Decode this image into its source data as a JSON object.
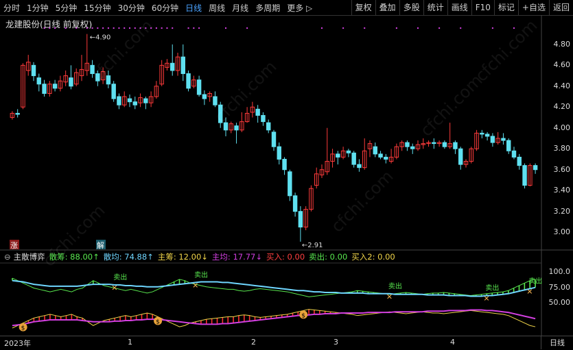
{
  "toolbar": {
    "left_items": [
      "分时",
      "1分钟",
      "5分钟",
      "15分钟",
      "30分钟",
      "60分钟",
      "日线",
      "周线",
      "月线",
      "多周期",
      "更多 ▷"
    ],
    "active_index": 6,
    "right_items": [
      "复权",
      "叠加",
      "多股",
      "统计",
      "画线",
      "F10",
      "标记",
      "+自选",
      "返回"
    ]
  },
  "title": "龙建股份(日线 前复权)",
  "price_axis": [
    "4.80",
    "4.60",
    "4.40",
    "4.20",
    "4.00",
    "3.80",
    "3.60",
    "3.40",
    "3.20",
    "3.00"
  ],
  "annotations": {
    "high": "4.90",
    "low": "2.91",
    "zhang": "涨",
    "jie": "解"
  },
  "indicator": {
    "name": "主散博弈",
    "items": [
      {
        "label": "散筹: 88.00↑",
        "color": "#59e84f"
      },
      {
        "label": "散均: 74.88↑",
        "color": "#6fd6ff"
      },
      {
        "label": "主筹: 12.00↓",
        "color": "#f2d64a"
      },
      {
        "label": "主均: 17.77↓",
        "color": "#d23fe0"
      },
      {
        "label": "买入: 0.00",
        "color": "#ff4040"
      },
      {
        "label": "卖出: 0.00",
        "color": "#59e84f"
      },
      {
        "label": "买入2: 0.00",
        "color": "#f2d64a"
      }
    ],
    "axis": [
      "100.0",
      "75.00",
      "50.00"
    ],
    "sell_label": "卖出"
  },
  "x_axis": [
    "2023年",
    "1",
    "2",
    "3",
    "4"
  ],
  "period": "日线",
  "watermark": "cfchi.com",
  "chart_data": {
    "type": "candlestick",
    "ylim": [
      2.85,
      4.95
    ],
    "candles": [
      [
        4.1,
        4.14,
        4.08,
        4.16
      ],
      [
        4.14,
        4.13,
        4.1,
        4.18
      ],
      [
        4.2,
        4.6,
        4.18,
        4.62
      ],
      [
        4.55,
        4.63,
        4.5,
        4.7
      ],
      [
        4.6,
        4.5,
        4.45,
        4.63
      ],
      [
        4.48,
        4.42,
        4.35,
        4.52
      ],
      [
        4.42,
        4.33,
        4.3,
        4.46
      ],
      [
        4.33,
        4.42,
        4.3,
        4.45
      ],
      [
        4.42,
        4.38,
        4.35,
        4.46
      ],
      [
        4.38,
        4.45,
        4.35,
        4.5
      ],
      [
        4.44,
        4.5,
        4.4,
        4.55
      ],
      [
        4.48,
        4.4,
        4.37,
        4.6
      ],
      [
        4.42,
        4.53,
        4.4,
        4.57
      ],
      [
        4.5,
        4.56,
        4.45,
        4.7
      ],
      [
        4.55,
        4.62,
        4.5,
        4.9
      ],
      [
        4.6,
        4.52,
        4.48,
        4.65
      ],
      [
        4.52,
        4.45,
        4.4,
        4.55
      ],
      [
        4.46,
        4.54,
        4.42,
        4.58
      ],
      [
        4.5,
        4.42,
        4.38,
        4.55
      ],
      [
        4.42,
        4.28,
        4.25,
        4.45
      ],
      [
        4.3,
        4.22,
        4.18,
        4.33
      ],
      [
        4.22,
        4.3,
        4.2,
        4.35
      ],
      [
        4.28,
        4.25,
        4.2,
        4.32
      ],
      [
        4.25,
        4.22,
        4.18,
        4.3
      ],
      [
        4.24,
        4.29,
        4.2,
        4.33
      ],
      [
        4.28,
        4.24,
        4.18,
        4.3
      ],
      [
        4.24,
        4.3,
        4.2,
        4.35
      ],
      [
        4.3,
        4.4,
        4.28,
        4.45
      ],
      [
        4.42,
        4.6,
        4.4,
        4.65
      ],
      [
        4.58,
        4.62,
        4.55,
        4.66
      ],
      [
        4.62,
        4.55,
        4.5,
        4.8
      ],
      [
        4.55,
        4.68,
        4.5,
        4.72
      ],
      [
        4.68,
        4.52,
        4.45,
        4.8
      ],
      [
        4.52,
        4.38,
        4.35,
        4.55
      ],
      [
        4.4,
        4.46,
        4.38,
        4.5
      ],
      [
        4.46,
        4.32,
        4.3,
        4.5
      ],
      [
        4.32,
        4.28,
        4.22,
        4.36
      ],
      [
        4.3,
        4.33,
        4.25,
        4.35
      ],
      [
        4.3,
        4.22,
        4.2,
        4.35
      ],
      [
        4.22,
        4.05,
        4.0,
        4.25
      ],
      [
        4.05,
        3.98,
        3.92,
        4.1
      ],
      [
        3.98,
        4.04,
        3.95,
        4.06
      ],
      [
        4.02,
        3.98,
        3.85,
        4.05
      ],
      [
        3.98,
        4.06,
        3.96,
        4.15
      ],
      [
        4.06,
        4.14,
        4.05,
        4.2
      ],
      [
        4.15,
        4.2,
        4.1,
        4.25
      ],
      [
        4.18,
        4.12,
        4.05,
        4.22
      ],
      [
        4.12,
        4.06,
        4.02,
        4.15
      ],
      [
        4.05,
        3.98,
        3.95,
        4.08
      ],
      [
        3.96,
        3.82,
        3.78,
        3.98
      ],
      [
        3.82,
        3.7,
        3.65,
        3.86
      ],
      [
        3.7,
        3.6,
        3.55,
        3.72
      ],
      [
        3.58,
        3.35,
        3.3,
        3.6
      ],
      [
        3.35,
        3.2,
        3.15,
        3.38
      ],
      [
        3.2,
        3.05,
        2.91,
        3.25
      ],
      [
        3.05,
        3.22,
        3.02,
        3.25
      ],
      [
        3.22,
        3.42,
        3.2,
        3.45
      ],
      [
        3.45,
        3.56,
        3.42,
        3.62
      ],
      [
        3.55,
        3.6,
        3.52,
        3.65
      ],
      [
        3.58,
        3.68,
        3.55,
        4.0
      ],
      [
        3.68,
        3.75,
        3.62,
        3.8
      ],
      [
        3.75,
        3.72,
        3.65,
        3.78
      ],
      [
        3.72,
        3.78,
        3.7,
        3.82
      ],
      [
        3.78,
        3.76,
        3.72,
        3.8
      ],
      [
        3.76,
        3.65,
        3.62,
        3.78
      ],
      [
        3.65,
        3.62,
        3.58,
        3.7
      ],
      [
        3.62,
        3.78,
        3.6,
        3.9
      ],
      [
        3.8,
        3.85,
        3.72,
        3.88
      ],
      [
        3.82,
        3.75,
        3.72,
        3.86
      ],
      [
        3.75,
        3.72,
        3.7,
        3.78
      ],
      [
        3.72,
        3.7,
        3.66,
        3.75
      ],
      [
        3.68,
        3.72,
        3.66,
        3.8
      ],
      [
        3.72,
        3.82,
        3.7,
        3.85
      ],
      [
        3.82,
        3.86,
        3.78,
        3.88
      ],
      [
        3.86,
        3.82,
        3.78,
        3.88
      ],
      [
        3.82,
        3.8,
        3.75,
        3.85
      ],
      [
        3.8,
        3.84,
        3.78,
        3.88
      ],
      [
        3.84,
        3.85,
        3.8,
        3.9
      ],
      [
        3.85,
        3.86,
        3.82,
        3.88
      ],
      [
        3.86,
        3.85,
        3.8,
        3.9
      ],
      [
        3.85,
        3.86,
        3.82,
        3.88
      ],
      [
        3.86,
        3.82,
        3.8,
        3.88
      ],
      [
        3.82,
        3.85,
        3.8,
        4.05
      ],
      [
        3.86,
        3.8,
        3.75,
        3.88
      ],
      [
        3.8,
        3.65,
        3.6,
        3.82
      ],
      [
        3.65,
        3.68,
        3.62,
        3.7
      ],
      [
        3.68,
        3.8,
        3.66,
        3.82
      ],
      [
        3.8,
        3.95,
        3.78,
        3.98
      ],
      [
        3.95,
        3.94,
        3.9,
        3.98
      ],
      [
        3.94,
        3.92,
        3.88,
        3.96
      ],
      [
        3.92,
        3.86,
        3.82,
        3.95
      ],
      [
        3.86,
        3.9,
        3.84,
        3.96
      ],
      [
        3.9,
        3.88,
        3.84,
        3.95
      ],
      [
        3.88,
        3.78,
        3.75,
        3.9
      ],
      [
        3.78,
        3.72,
        3.7,
        3.82
      ],
      [
        3.72,
        3.64,
        3.6,
        3.75
      ],
      [
        3.64,
        3.45,
        3.42,
        3.66
      ],
      [
        3.45,
        3.64,
        3.44,
        3.66
      ],
      [
        3.64,
        3.6,
        3.56,
        3.66
      ]
    ],
    "sanchou": [
      90,
      86,
      82,
      78,
      74,
      72,
      70,
      68,
      70,
      72,
      70,
      68,
      72,
      74,
      80,
      86,
      82,
      78,
      76,
      74,
      72,
      70,
      72,
      70,
      68,
      66,
      68,
      72,
      76,
      80,
      84,
      88,
      86,
      82,
      80,
      78,
      76,
      75,
      74,
      73,
      72,
      72,
      70,
      69,
      70,
      72,
      73,
      72,
      71,
      70,
      69,
      68,
      66,
      64,
      62,
      60,
      61,
      62,
      63,
      64,
      65,
      66,
      67,
      68,
      70,
      69,
      68,
      67,
      66,
      65,
      64,
      65,
      66,
      67,
      66,
      65,
      64,
      65,
      66,
      66,
      67,
      66,
      65,
      64,
      63,
      62,
      63,
      64,
      65,
      66,
      67,
      68,
      70,
      74,
      78,
      82,
      86,
      88
    ],
    "sanjun": [
      86,
      85,
      84,
      82,
      80,
      79,
      78,
      77,
      77,
      77,
      77,
      77,
      77,
      78,
      79,
      80,
      80,
      80,
      80,
      79,
      79,
      78,
      78,
      77,
      77,
      76,
      76,
      76,
      77,
      78,
      79,
      80,
      81,
      82,
      83,
      84,
      84,
      84,
      84,
      83,
      83,
      82,
      81,
      80,
      79,
      78,
      77,
      76,
      75,
      74,
      73,
      72,
      71,
      70,
      70,
      69,
      68,
      68,
      67,
      67,
      67,
      66,
      66,
      66,
      66,
      66,
      65,
      65,
      65,
      65,
      65,
      64,
      64,
      64,
      64,
      64,
      64,
      63,
      63,
      63,
      63,
      62,
      62,
      62,
      62,
      61,
      61,
      61,
      62,
      62,
      63,
      64,
      65,
      67,
      69,
      71,
      73,
      75
    ],
    "zhuchou": [
      10,
      14,
      18,
      22,
      26,
      28,
      30,
      32,
      30,
      28,
      30,
      32,
      28,
      26,
      20,
      14,
      18,
      22,
      24,
      26,
      28,
      30,
      28,
      30,
      32,
      34,
      32,
      28,
      24,
      20,
      16,
      12,
      14,
      18,
      20,
      22,
      24,
      25,
      26,
      27,
      28,
      28,
      30,
      31,
      30,
      28,
      27,
      28,
      29,
      30,
      31,
      32,
      34,
      36,
      38,
      40,
      39,
      38,
      37,
      36,
      35,
      34,
      33,
      32,
      30,
      31,
      32,
      33,
      34,
      35,
      36,
      35,
      34,
      33,
      34,
      35,
      36,
      35,
      34,
      34,
      33,
      34,
      35,
      36,
      37,
      38,
      37,
      36,
      35,
      34,
      33,
      32,
      30,
      26,
      22,
      18,
      14,
      12
    ],
    "zhujun": [
      14,
      15,
      16,
      18,
      20,
      21,
      22,
      23,
      23,
      23,
      23,
      23,
      23,
      22,
      21,
      20,
      20,
      20,
      20,
      21,
      21,
      22,
      22,
      23,
      23,
      24,
      24,
      24,
      23,
      22,
      21,
      20,
      19,
      18,
      17,
      16,
      16,
      16,
      16,
      17,
      17,
      18,
      19,
      20,
      21,
      22,
      23,
      24,
      25,
      26,
      27,
      28,
      29,
      30,
      30,
      31,
      32,
      32,
      33,
      33,
      33,
      34,
      34,
      34,
      34,
      34,
      35,
      35,
      35,
      35,
      35,
      36,
      36,
      36,
      36,
      36,
      36,
      37,
      37,
      37,
      37,
      38,
      38,
      38,
      38,
      39,
      39,
      39,
      38,
      38,
      37,
      36,
      35,
      33,
      31,
      29,
      27,
      25
    ],
    "ind_ylim": [
      0,
      112
    ],
    "markers": {
      "ding_idx": [
        19,
        34,
        70,
        88,
        96
      ],
      "money_idx": [
        2,
        27,
        54
      ]
    }
  }
}
